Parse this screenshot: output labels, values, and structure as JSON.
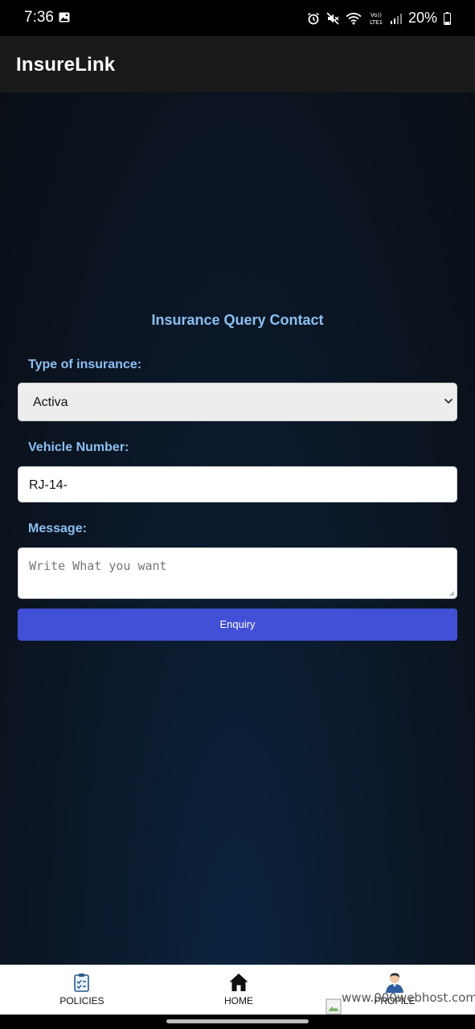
{
  "status_bar": {
    "time": "7:36",
    "battery": "20%",
    "icons": [
      "gallery-icon",
      "alarm-icon",
      "mute-icon",
      "wifi-icon",
      "volte-icon",
      "signal-icon",
      "battery-icon"
    ],
    "volte_text_top": "Vo))",
    "volte_text_bottom": "LTE1"
  },
  "app_bar": {
    "title": "InsureLink"
  },
  "form": {
    "title": "Insurance Query Contact",
    "insurance_type_label": "Type of insurance:",
    "insurance_type_value": "Activa",
    "vehicle_number_label": "Vehicle Number:",
    "vehicle_number_value": "RJ-14-",
    "message_label": "Message:",
    "message_placeholder": "Write What you want",
    "submit_label": "Enquiry"
  },
  "bottom_nav": {
    "items": [
      {
        "label": "POLICIES",
        "icon": "clipboard-check-icon"
      },
      {
        "label": "HOME",
        "icon": "home-icon"
      },
      {
        "label": "PROFILE",
        "icon": "user-avatar-icon"
      }
    ],
    "watermark": "www.000webhost.com"
  },
  "colors": {
    "accent_label": "#8cc0f2",
    "button": "#4150d6",
    "app_bar": "#1a1a1b"
  }
}
